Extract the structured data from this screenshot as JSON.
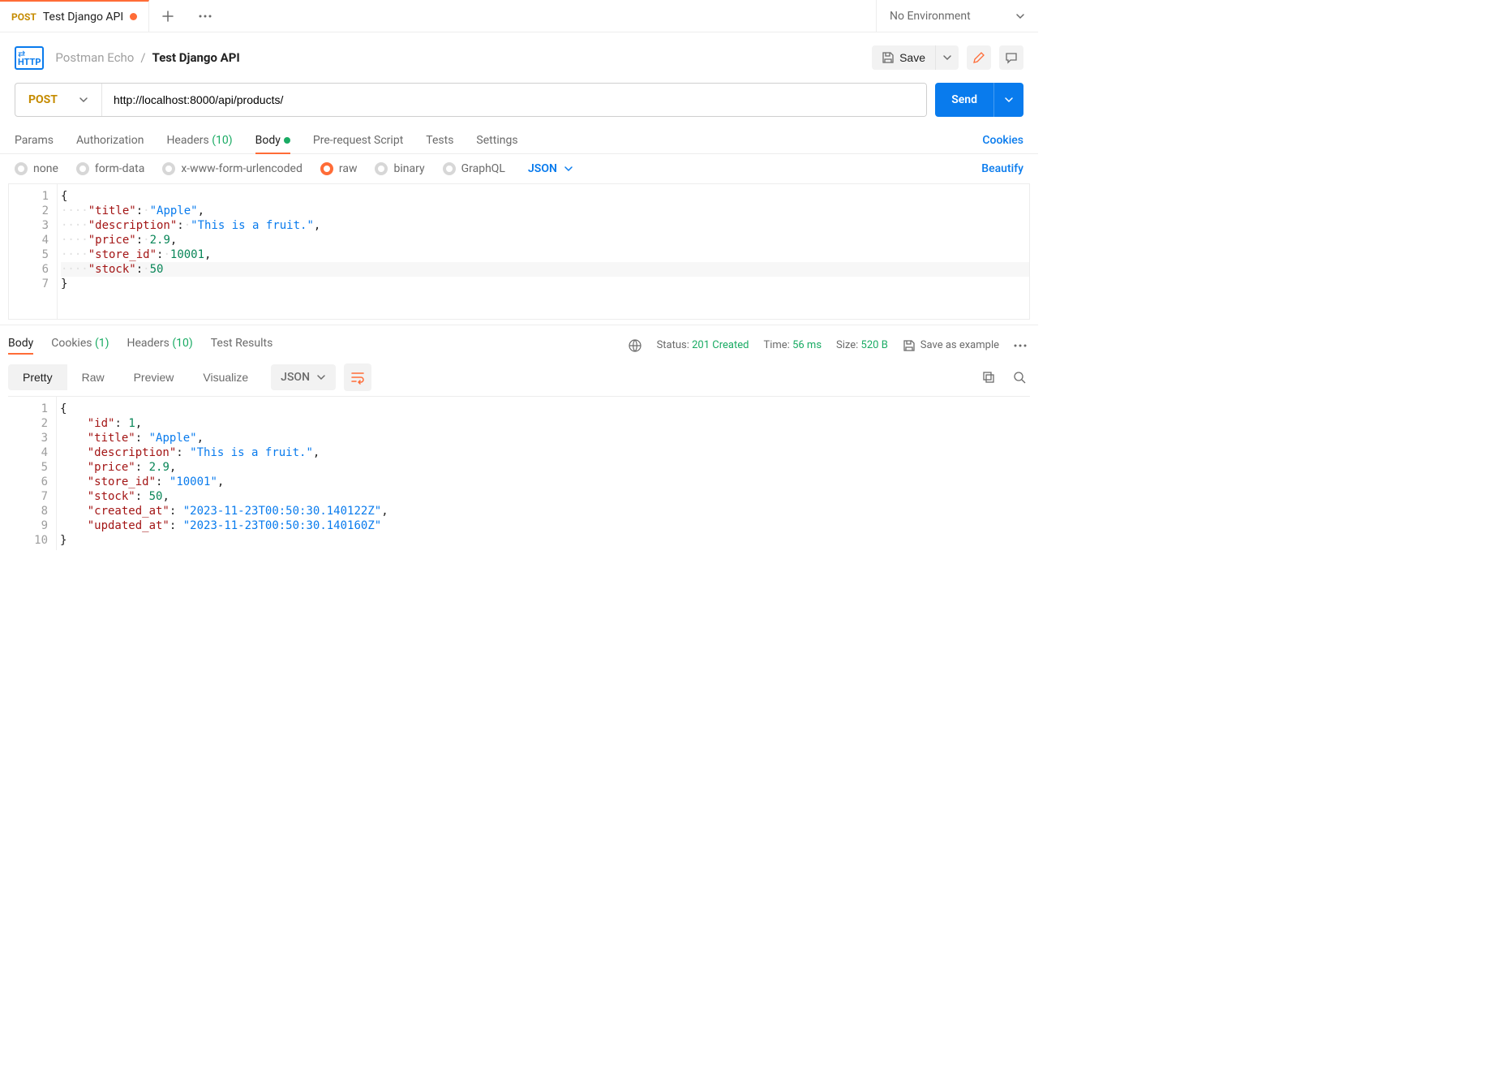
{
  "tab": {
    "method": "POST",
    "title": "Test Django API"
  },
  "env": {
    "label": "No Environment"
  },
  "breadcrumb": {
    "collection": "Postman Echo",
    "sep": "/",
    "request": "Test Django API"
  },
  "actions": {
    "save": "Save"
  },
  "request": {
    "method": "POST",
    "url": "http://localhost:8000/api/products/",
    "send": "Send",
    "tabs": {
      "params": "Params",
      "auth": "Authorization",
      "headers": "Headers",
      "headers_count": "(10)",
      "body": "Body",
      "prerequest": "Pre-request Script",
      "tests": "Tests",
      "settings": "Settings"
    },
    "cookies_link": "Cookies",
    "body_types": {
      "none": "none",
      "formdata": "form-data",
      "urlencoded": "x-www-form-urlencoded",
      "raw": "raw",
      "binary": "binary",
      "graphql": "GraphQL"
    },
    "body_lang": "JSON",
    "beautify": "Beautify",
    "body_json": {
      "title": "Apple",
      "description": "This is a fruit.",
      "price": 2.9,
      "store_id": 10001,
      "stock": 50
    }
  },
  "response": {
    "tabs": {
      "body": "Body",
      "cookies": "Cookies",
      "cookies_count": "(1)",
      "headers": "Headers",
      "headers_count": "(10)",
      "testresults": "Test Results"
    },
    "meta": {
      "status_label": "Status:",
      "status_value": "201 Created",
      "time_label": "Time:",
      "time_value": "56 ms",
      "size_label": "Size:",
      "size_value": "520 B",
      "save_example": "Save as example"
    },
    "views": {
      "pretty": "Pretty",
      "raw": "Raw",
      "preview": "Preview",
      "visualize": "Visualize",
      "lang": "JSON"
    },
    "body_json": {
      "id": 1,
      "title": "Apple",
      "description": "This is a fruit.",
      "price": 2.9,
      "store_id": "10001",
      "stock": 50,
      "created_at": "2023-11-23T00:50:30.140122Z",
      "updated_at": "2023-11-23T00:50:30.140160Z"
    }
  }
}
